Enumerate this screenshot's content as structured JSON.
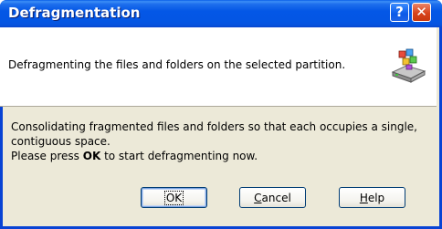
{
  "window": {
    "title": "Defragmentation",
    "help_glyph": "?",
    "close_glyph": "✕"
  },
  "header": {
    "text": "Defragmenting the files and folders on the selected partition.",
    "icon": "defrag-drive-icon"
  },
  "body": {
    "line1": "Consolidating fragmented files and folders so that each occupies a single, contiguous space.",
    "line2_prefix": "Please press ",
    "line2_bold": "OK",
    "line2_suffix": " to start defragmenting now."
  },
  "buttons": {
    "ok_label": "OK",
    "cancel_first": "C",
    "cancel_rest": "ancel",
    "help_first": "H",
    "help_rest": "elp"
  },
  "colors": {
    "titlebar": "#0457e6",
    "window_bg": "#ece9d8",
    "header_bg": "#ffffff",
    "close_button": "#d8431b"
  }
}
